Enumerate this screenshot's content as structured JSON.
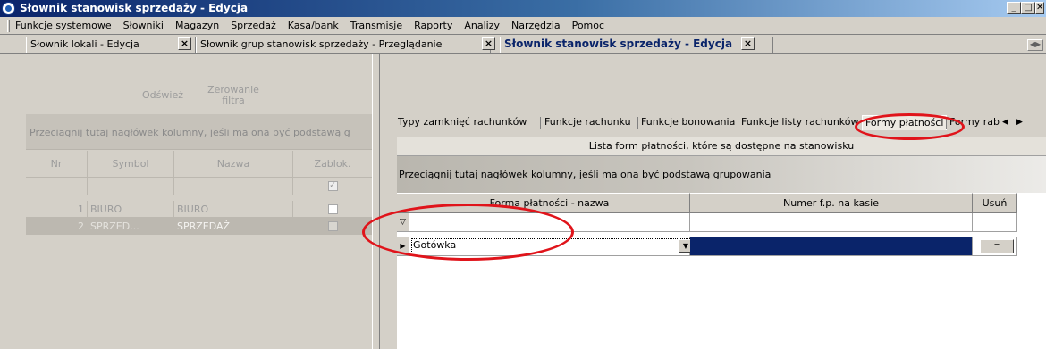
{
  "window": {
    "title": "Słownik stanowisk sprzedaży - Edycja",
    "controls": [
      "_",
      "□",
      "✕"
    ]
  },
  "menu": [
    "Funkcje systemowe",
    "Słowniki",
    "Magazyn",
    "Sprzedaż",
    "Kasa/bank",
    "Transmisje",
    "Raporty",
    "Analizy",
    "Narzędzia",
    "Pomoc"
  ],
  "mdi_tabs": [
    {
      "label": "Słownik lokali - Edycja",
      "active": false
    },
    {
      "label": "Słownik grup stanowisk sprzedaży - Przeglądanie",
      "active": false
    },
    {
      "label": "Słownik stanowisk sprzedaży - Edycja",
      "active": true
    }
  ],
  "left": {
    "refresh_label": "Odśwież",
    "reset_filter_label": "Zerowanie filtra",
    "group_hint": "Przeciągnij tutaj nagłówek kolumny, jeśli ma ona być podstawą g",
    "columns": [
      "Nr",
      "Symbol",
      "Nazwa",
      "Zablok."
    ],
    "rows": [
      {
        "nr": "1",
        "symbol": "BIURO",
        "nazwa": "BIURO",
        "locked": false
      },
      {
        "nr": "2",
        "symbol": "SPRZED...",
        "nazwa": "SPRZEDAŻ",
        "locked": false
      }
    ]
  },
  "right": {
    "tabs": [
      "Typy zamknięć rachunków",
      "Funkcje rachunku",
      "Funkcje bonowania",
      "Funkcje listy rachunków",
      "Formy płatności",
      "Formy rab"
    ],
    "active_tab": "Formy płatności",
    "list_title": "Lista form płatności, które są dostępne na stanowisku",
    "group_hint": "Przeciągnij tutaj nagłówek kolumny, jeśli ma ona być podstawą grupowania",
    "columns": [
      "Forma płatności - nazwa",
      "Numer f.p. na kasie",
      "Usuń"
    ],
    "rows": [
      {
        "forma": "Gotówka",
        "numer": "",
        "delete_label": "–"
      }
    ]
  },
  "annotation_color": "#e0141b"
}
